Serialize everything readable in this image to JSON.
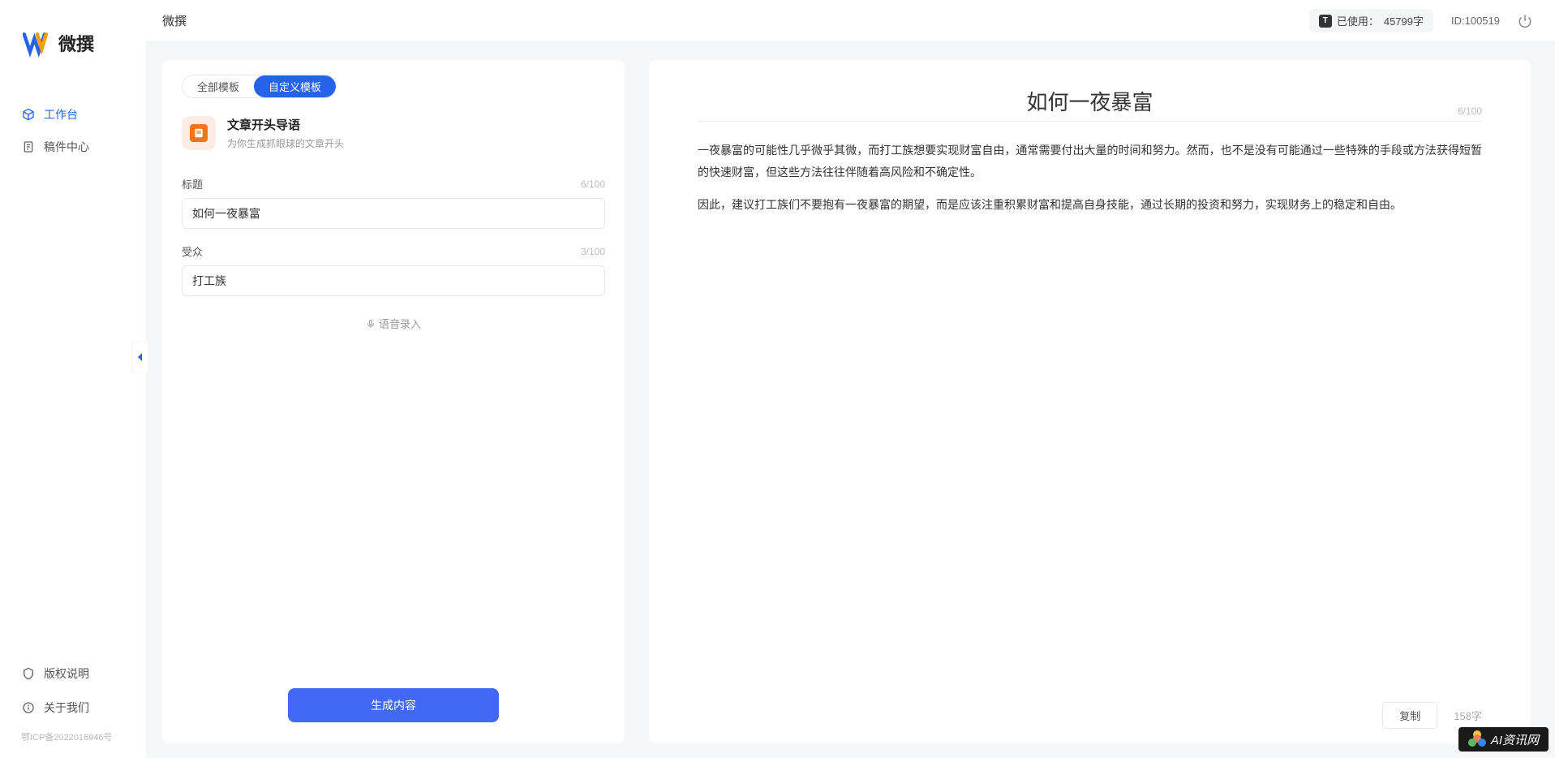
{
  "app": {
    "name": "微撰",
    "header_title": "微撰"
  },
  "header": {
    "usage_label": "已使用：",
    "usage_value": "45799字",
    "id_label": "ID:100519"
  },
  "sidebar": {
    "items": [
      {
        "label": "工作台",
        "active": true
      },
      {
        "label": "稿件中心",
        "active": false
      }
    ],
    "bottom": [
      {
        "label": "版权说明"
      },
      {
        "label": "关于我们"
      }
    ],
    "icp": "鄂ICP备2022016946号"
  },
  "tabs": {
    "all": "全部模板",
    "custom": "自定义模板"
  },
  "template": {
    "name": "文章开头导语",
    "desc": "为你生成抓眼球的文章开头"
  },
  "fields": {
    "title": {
      "label": "标题",
      "value": "如何一夜暴富",
      "count": "6/100"
    },
    "audience": {
      "label": "受众",
      "value": "打工族",
      "count": "3/100"
    }
  },
  "voice_hint": "语音录入",
  "generate_label": "生成内容",
  "output": {
    "title": "如何一夜暴富",
    "title_count": "6/100",
    "para1": "一夜暴富的可能性几乎微乎其微，而打工族想要实现财富自由，通常需要付出大量的时间和努力。然而，也不是没有可能通过一些特殊的手段或方法获得短暂的快速财富，但这些方法往往伴随着高风险和不确定性。",
    "para2": "因此，建议打工族们不要抱有一夜暴富的期望，而是应该注重积累财富和提高自身技能，通过长期的投资和努力，实现财务上的稳定和自由。",
    "copy_label": "复制",
    "char_count": "158字"
  },
  "watermark": "AI资讯网"
}
